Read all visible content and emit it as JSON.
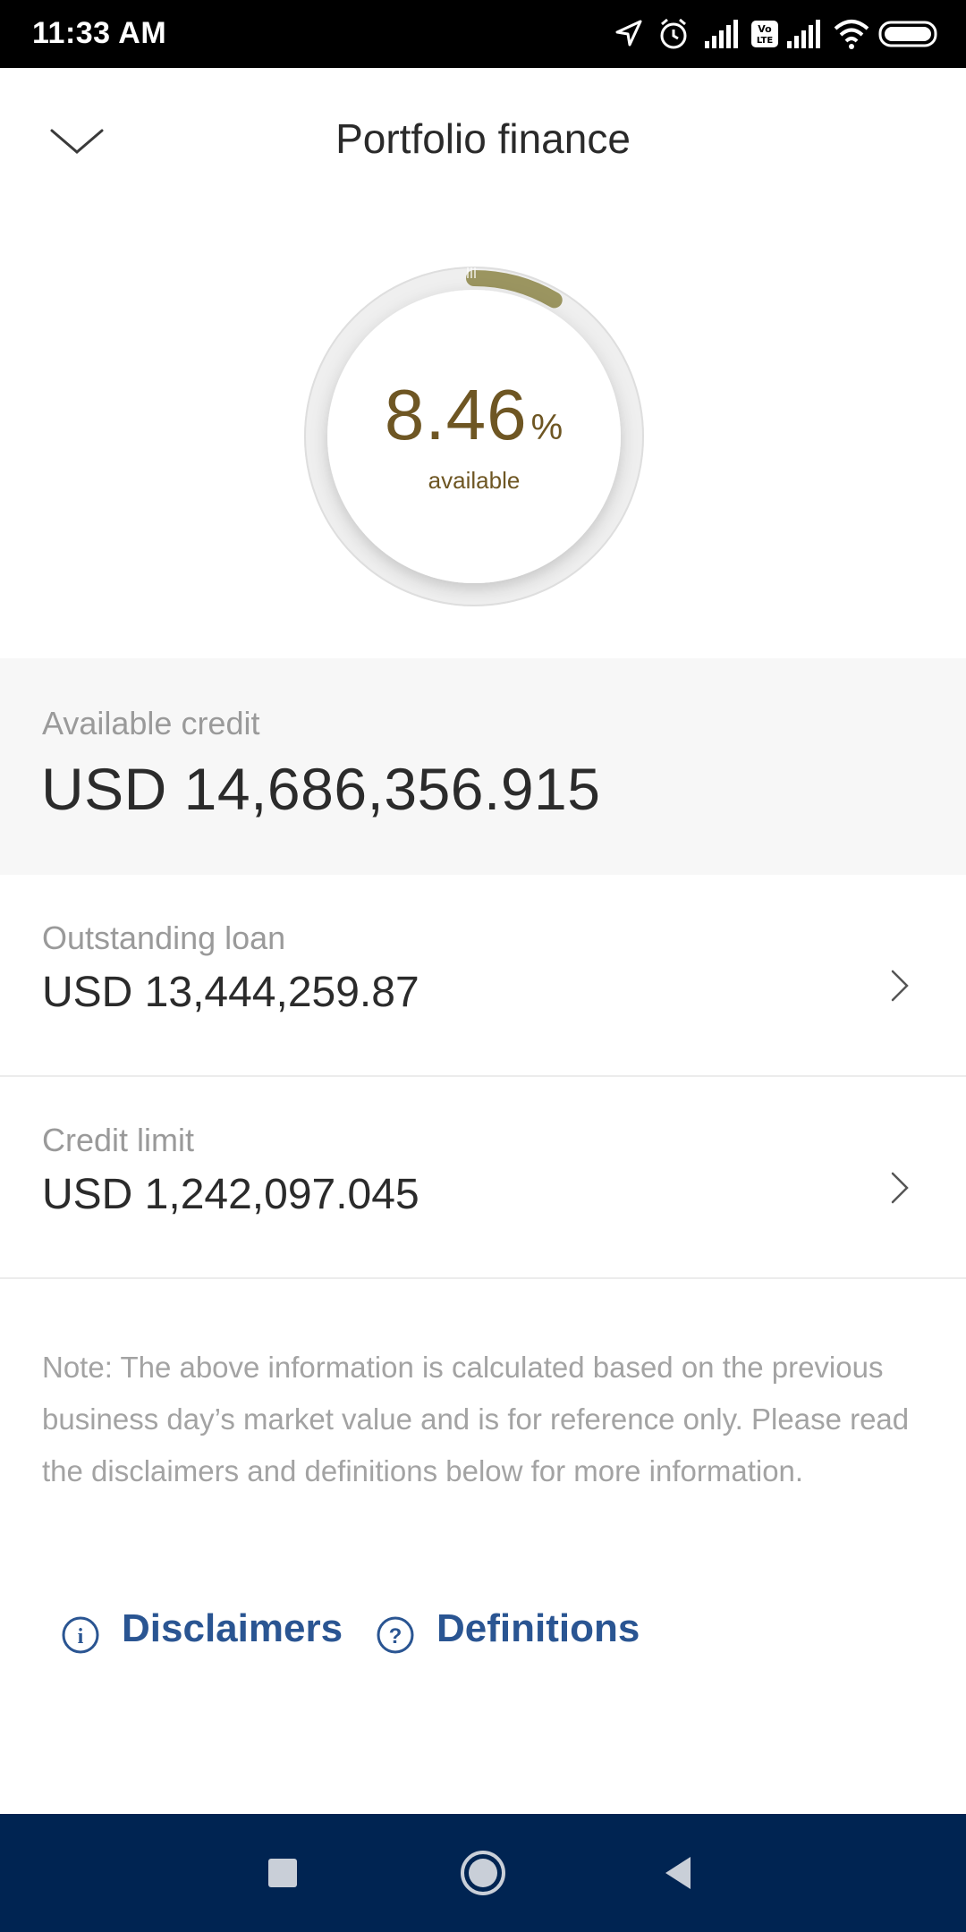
{
  "status_bar": {
    "time": "11:33 AM",
    "icons": [
      "location-arrow-icon",
      "alarm-icon",
      "signal-icon",
      "volte-icon",
      "signal-icon",
      "wifi-icon",
      "battery-icon"
    ],
    "volte_text": "Vo LTE"
  },
  "header": {
    "title": "Portfolio finance",
    "collapse_icon": "chevron-down-icon"
  },
  "gauge": {
    "value": "8.46",
    "unit": "%",
    "caption": "available",
    "fraction": 0.0846,
    "arc_color": "#9b9560",
    "text_color": "#6e5623"
  },
  "available_credit": {
    "label": "Available credit",
    "value": "USD 14,686,356.915"
  },
  "rows": [
    {
      "label": "Outstanding loan",
      "value": "USD 13,444,259.87",
      "icon": "chevron-right-icon"
    },
    {
      "label": "Credit limit",
      "value": "USD 1,242,097.045",
      "icon": "chevron-right-icon"
    }
  ],
  "note": "Note: The above information is calculated based on the previous business day’s market value and is for reference only. Please read the disclaimers and definitions below for more information.",
  "links": [
    {
      "label": "Disclaimers",
      "icon": "info-icon",
      "glyph": "i"
    },
    {
      "label": "Definitions",
      "icon": "help-icon",
      "glyph": "?"
    }
  ],
  "nav_bar": {
    "buttons": [
      "recent-apps-icon",
      "home-icon",
      "back-icon"
    ],
    "color": "#002452"
  },
  "colors": {
    "link": "#2a5592",
    "label_grey": "#9a9a9a",
    "panel_bg": "#f7f7f7"
  }
}
